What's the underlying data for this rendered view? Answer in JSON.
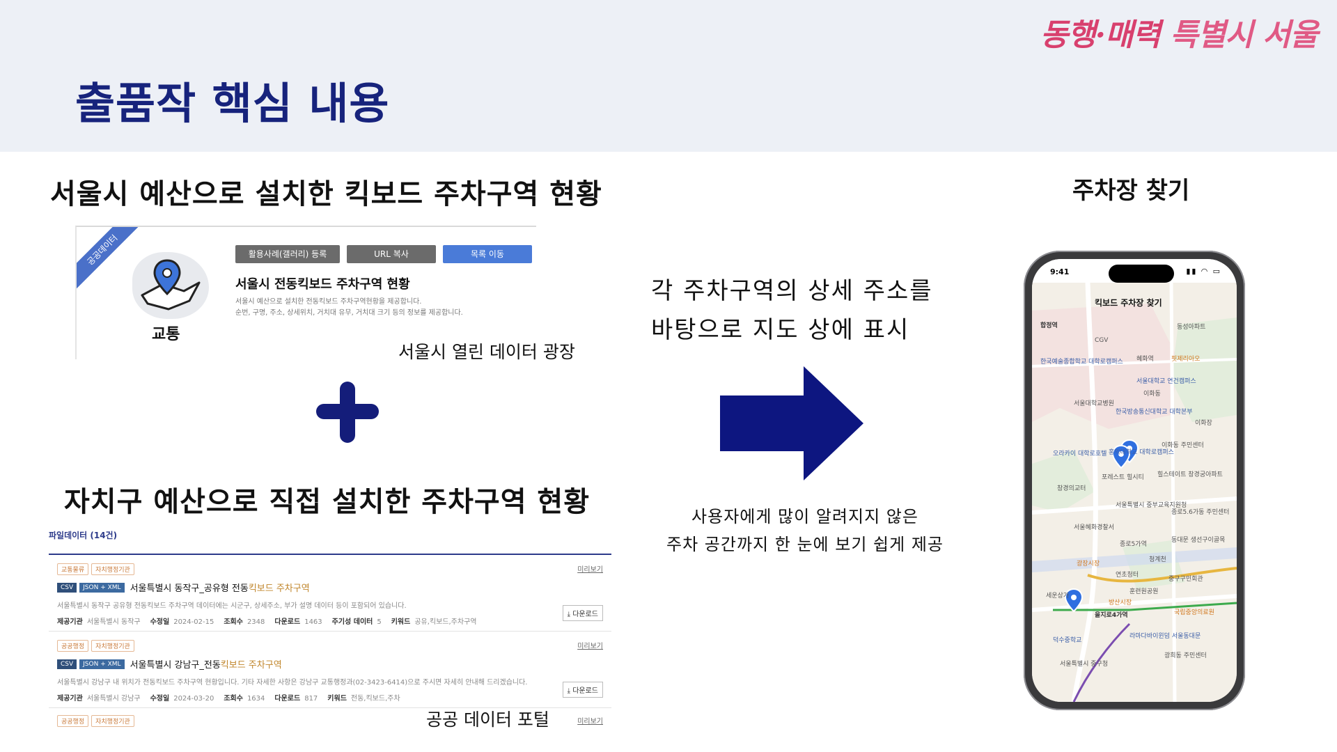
{
  "header": {
    "title": "출품작 핵심 내용",
    "brand_part1": "동행·매력",
    "brand_part2": "특별시 서울"
  },
  "left": {
    "heading1": "서울시 예산으로 설치한 킥보드 주차구역 현황",
    "heading2": "자치구 예산으로 직접 설치한 주차구역 현황",
    "source1": "서울시 열린 데이터 광장",
    "source2": "공공 데이터 포털"
  },
  "seoul_card": {
    "ribbon": "공공데이터",
    "category": "교통",
    "buttons": [
      "활용사례(갤러리) 등록",
      "URL 복사",
      "목록 이동"
    ],
    "title": "서울시 전동킥보드 주차구역 현황",
    "desc_line1": "서울시 예산으로 설치한 전동킥보드 주차구역현황을 제공합니다.",
    "desc_line2": "순번, 구명, 주소, 상세위치, 거치대 유무, 거치대 크기 등의 정보를 제공합니다."
  },
  "portal": {
    "header": "파일데이터 (14건)",
    "rows": [
      {
        "tag1": "교통물류",
        "tag2": "자치행정기관",
        "preview": "미리보기",
        "fmt1": "CSV",
        "fmt2": "JSON + XML",
        "name_prefix": "서울특별시 동작구_공유형 전동",
        "name_highlight": "킥보드 주차구역",
        "desc": "서울특별시 동작구 공유형 전동킥보드 주차구역 데이터에는 시군구, 상세주소, 부가 설명 데이터 등이 포함되어 있습니다.",
        "provider_label": "제공기관",
        "provider": "서울특별시 동작구",
        "modified_label": "수정일",
        "modified": "2024-02-15",
        "views_label": "조회수",
        "views": "2348",
        "downloads_label": "다운로드",
        "downloads": "1463",
        "extra_label": "주기성 데이터",
        "extra": "5",
        "keyword_label": "키워드",
        "keywords": "공유,킥보드,주차구역",
        "download_btn": "다운로드"
      },
      {
        "tag1": "공공행정",
        "tag2": "자치행정기관",
        "preview": "미리보기",
        "fmt1": "CSV",
        "fmt2": "JSON + XML",
        "name_prefix": "서울특별시 강남구_전동",
        "name_highlight": "킥보드 주차구역",
        "desc": "서울특별시 강남구 내 위치가 전동킥보드 주차구역 현황입니다. 기타 자세한 사항은 강남구 교통행정과(02-3423-6414)으로 주시면 자세히 안내해 드리겠습니다.",
        "provider_label": "제공기관",
        "provider": "서울특별시 강남구",
        "modified_label": "수정일",
        "modified": "2024-03-20",
        "views_label": "조회수",
        "views": "1634",
        "downloads_label": "다운로드",
        "downloads": "817",
        "keyword_label": "키워드",
        "keywords": "전동,킥보드,주차",
        "download_btn": "다운로드"
      }
    ],
    "last_row": {
      "tag1": "공공행정",
      "tag2": "자치행정기관",
      "preview": "미리보기"
    }
  },
  "middle": {
    "text_line1": "각 주차구역의 상세 주소를",
    "text_line2": "바탕으로 지도 상에 표시",
    "sub_line1": "사용자에게 많이 알려지지 않은",
    "sub_line2": "주차 공간까지 한 눈에 보기 쉽게 제공",
    "arrow_color": "#0d1680"
  },
  "phone": {
    "label": "주차장 찾기",
    "time": "9:41",
    "status_icons": "▮▮ ◠ ▭",
    "app_title": "킥보드 주차장 찾기",
    "map_labels": [
      {
        "text": "합정역",
        "style": "dark"
      },
      {
        "text": "CGV",
        "style": ""
      },
      {
        "text": "동성아파트",
        "style": ""
      },
      {
        "text": "한국예술종합학교 대학로캠퍼스",
        "style": "blue"
      },
      {
        "text": "혜화역",
        "style": ""
      },
      {
        "text": "핏제리아오",
        "style": "orange"
      },
      {
        "text": "서울대학교 연건캠퍼스",
        "style": "blue"
      },
      {
        "text": "이화동",
        "style": ""
      },
      {
        "text": "서울대학교병원",
        "style": ""
      },
      {
        "text": "한국방송통신대학교 대학본부",
        "style": "blue"
      },
      {
        "text": "이화장",
        "style": ""
      },
      {
        "text": "홍익대학교 대학로캠퍼스",
        "style": "blue"
      },
      {
        "text": "이화동 주민센터",
        "style": ""
      },
      {
        "text": "오라카이 대학로호텔",
        "style": "blue"
      },
      {
        "text": "포레스트 힐시티",
        "style": ""
      },
      {
        "text": "힐스테이트 창경궁아파트",
        "style": ""
      },
      {
        "text": "창경의교터",
        "style": ""
      },
      {
        "text": "서울특별시 중부교육지원청",
        "style": ""
      },
      {
        "text": "종로5.6가동 주민센터",
        "style": ""
      },
      {
        "text": "서울혜화경찰서",
        "style": ""
      },
      {
        "text": "종로5가역",
        "style": ""
      },
      {
        "text": "동대문 생선구이골목",
        "style": ""
      },
      {
        "text": "광장시장",
        "style": "orange"
      },
      {
        "text": "청계천",
        "style": ""
      },
      {
        "text": "연초청터",
        "style": ""
      },
      {
        "text": "중구구민회관",
        "style": ""
      },
      {
        "text": "훈련원공원",
        "style": ""
      },
      {
        "text": "세운상가",
        "style": ""
      },
      {
        "text": "을지로4가역",
        "style": ""
      },
      {
        "text": "방산시장",
        "style": "orange"
      },
      {
        "text": "국립중앙의료원",
        "style": "orange"
      },
      {
        "text": "덕수중학교",
        "style": "blue"
      },
      {
        "text": "라마다바이윈덤 서울동대문",
        "style": "blue"
      },
      {
        "text": "광희동 주민센터",
        "style": ""
      },
      {
        "text": "서울특별시 중구청",
        "style": ""
      }
    ]
  }
}
